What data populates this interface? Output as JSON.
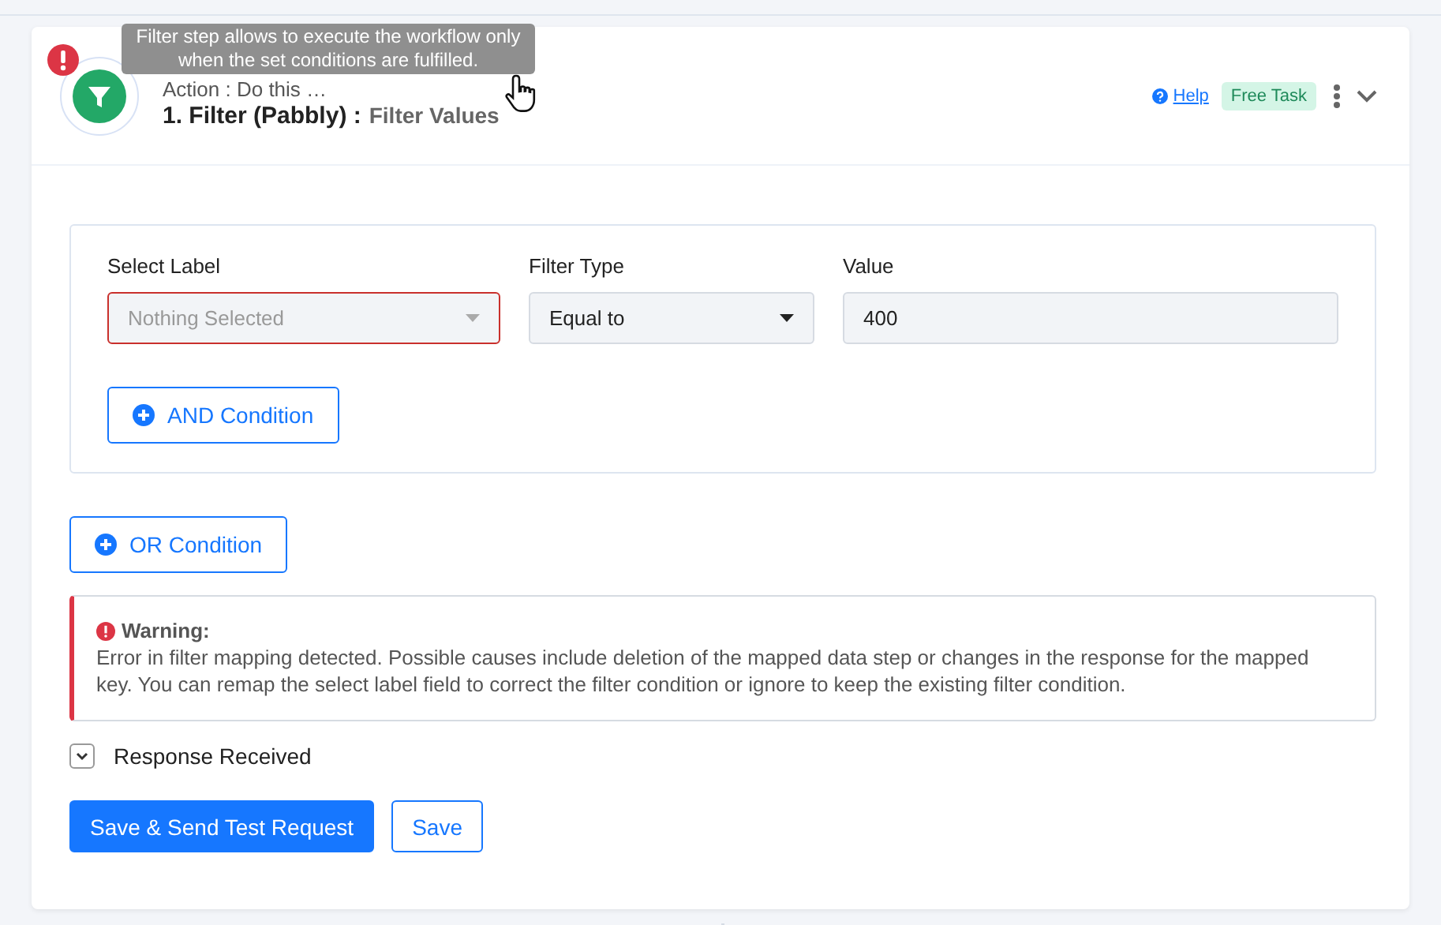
{
  "tooltip": "Filter step allows to execute the workflow only when the set conditions are fulfilled.",
  "step": {
    "error": true,
    "subtitle": "Action : Do this …",
    "title": "1. Filter (Pabbly) :",
    "event": "Filter Values",
    "help": "Help",
    "badge": "Free Task",
    "expanded": true
  },
  "condition_group": {
    "fields": [
      {
        "kind": "select",
        "label": "Select Label",
        "placeholder": "Nothing Selected",
        "invalid": true
      },
      {
        "kind": "select",
        "label": "Filter Type",
        "value": "Equal to",
        "invalid": false
      },
      {
        "kind": "input",
        "label": "Value",
        "value": "400",
        "invalid": false
      }
    ],
    "and_button": "AND Condition"
  },
  "or_button": "OR Condition",
  "warning": {
    "title": "Warning:",
    "message": "Error in filter mapping detected. Possible causes include deletion of the mapped data step or changes in the response for the mapped key. You can remap the select label field to correct the filter condition or ignore to keep the existing filter condition."
  },
  "response": {
    "label": "Response Received",
    "expanded": false
  },
  "buttons": [
    {
      "kind": "primary",
      "label": "Save & Send Test Request"
    },
    {
      "kind": "outline",
      "label": "Save"
    }
  ]
}
